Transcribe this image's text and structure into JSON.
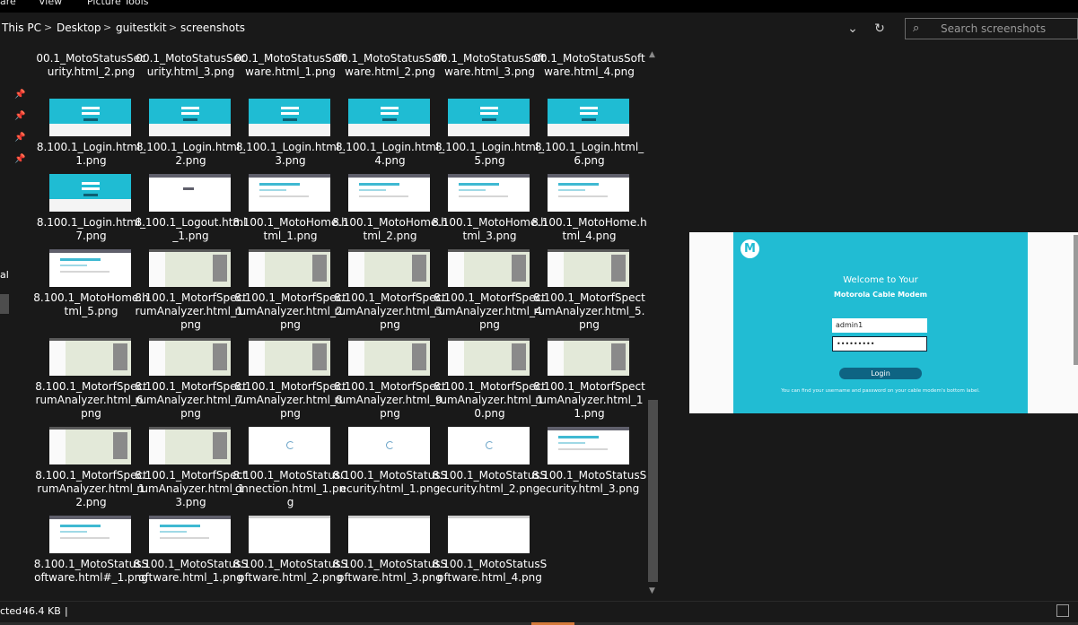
{
  "ribbon": {
    "tab_share": "are",
    "tab_view": "View",
    "tab_picture_tools": "Picture Tools"
  },
  "breadcrumb": {
    "items": [
      "This PC",
      "Desktop",
      "guitestkit",
      "screenshots"
    ],
    "separator": ">"
  },
  "address_controls": {
    "dropdown_icon": "chevron-down-icon",
    "refresh_icon": "refresh-icon"
  },
  "search": {
    "placeholder": "Search screenshots",
    "icon": "search-icon"
  },
  "nav": {
    "partial_label": "al",
    "pin_icon": "pin-icon"
  },
  "files": [
    "00.1_MotoStatusSecurity.html_2.png",
    "00.1_MotoStatusSecurity.html_3.png",
    "00.1_MotoStatusSoftware.html_1.png",
    "00.1_MotoStatusSoftware.html_2.png",
    "00.1_MotoStatusSoftware.html_3.png",
    "00.1_MotoStatusSoftware.html_4.png",
    "8.100.1_Login.html_1.png",
    "8.100.1_Login.html_2.png",
    "8.100.1_Login.html_3.png",
    "8.100.1_Login.html_4.png",
    "8.100.1_Login.html_5.png",
    "8.100.1_Login.html_6.png",
    "8.100.1_Login.html_7.png",
    "8.100.1_Logout.html_1.png",
    "8.100.1_MotoHome.html_1.png",
    "8.100.1_MotoHome.html_2.png",
    "8.100.1_MotoHome.html_3.png",
    "8.100.1_MotoHome.html_4.png",
    "8.100.1_MotoHome.html_5.png",
    "8.100.1_MotorfSpectrumAnalyzer.html_1.png",
    "8.100.1_MotorfSpectrumAnalyzer.html_2.png",
    "8.100.1_MotorfSpectrumAnalyzer.html_3.png",
    "8.100.1_MotorfSpectrumAnalyzer.html_4.png",
    "8.100.1_MotorfSpectrumAnalyzer.html_5.png",
    "8.100.1_MotorfSpectrumAnalyzer.html_6.png",
    "8.100.1_MotorfSpectrumAnalyzer.html_7.png",
    "8.100.1_MotorfSpectrumAnalyzer.html_8.png",
    "8.100.1_MotorfSpectrumAnalyzer.html_9.png",
    "8.100.1_MotorfSpectrumAnalyzer.html_10.png",
    "8.100.1_MotorfSpectrumAnalyzer.html_11.png",
    "8.100.1_MotorfSpectrumAnalyzer.html_12.png",
    "8.100.1_MotorfSpectrumAnalyzer.html_13.png",
    "8.100.1_MotoStatusConnection.html_1.png",
    "8.100.1_MotoStatusSecurity.html_1.png",
    "8.100.1_MotoStatusSecurity.html_2.png",
    "8.100.1_MotoStatusSecurity.html_3.png",
    "8.100.1_MotoStatusSoftware.html#_1.png",
    "8.100.1_MotoStatusSoftware.html_1.png",
    "8.100.1_MotoStatusSoftware.html_2.png",
    "8.100.1_MotoStatusSoftware.html_3.png",
    "8.100.1_MotoStatusSoftware.html_4.png"
  ],
  "preview": {
    "logo": "motorola-logo",
    "welcome": "Welcome to Your",
    "subtitle": "Motorola Cable Modem",
    "username_value": "admin1",
    "password_value": "•••••••••",
    "login_label": "Login",
    "hint": "You can find your username and password on your cable modem's bottom label."
  },
  "status": {
    "selected": "cted",
    "size": "46.4 KB",
    "divider": "|"
  },
  "colors": {
    "accent_cyan": "#21bcd3",
    "background": "#191919",
    "login_button": "#0e6483"
  }
}
